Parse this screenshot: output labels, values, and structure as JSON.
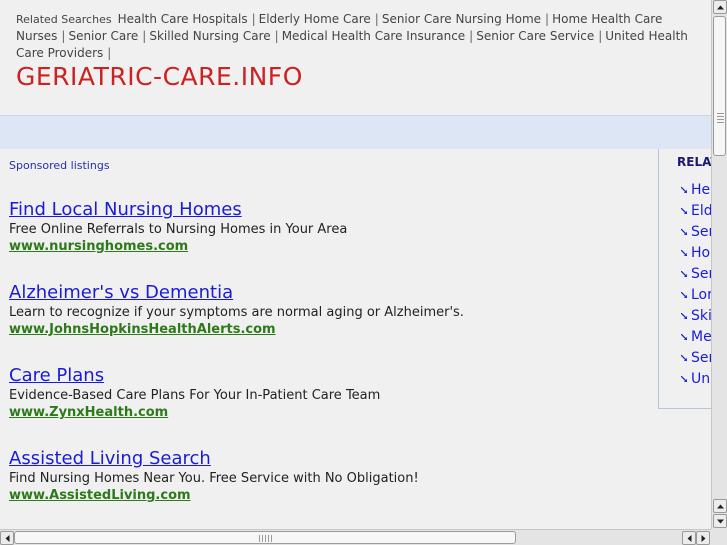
{
  "related_bar": {
    "label": "Related Searches",
    "items": [
      "Health Care Hospitals",
      "Elderly Home Care",
      "Senior Care Nursing Home",
      "Home Health Care Nurses",
      "Senior Care",
      "Skilled Nursing Care",
      "Medical Health Care Insurance",
      "Senior Care Service",
      "United Health Care Providers"
    ],
    "separator": "|"
  },
  "site_title": "GERIATRIC-CARE.INFO",
  "sponsored_label": "Sponsored listings",
  "ads": [
    {
      "title": "Find Local Nursing Homes",
      "desc": "Free Online Referrals to Nursing Homes in Your Area",
      "url": "www.nursinghomes.com"
    },
    {
      "title": "Alzheimer's vs Dementia",
      "desc": "Learn to recognize if your symptoms are normal aging or Alzheimer's.",
      "url": "www.JohnsHopkinsHealthAlerts.com"
    },
    {
      "title": "Care Plans",
      "desc": "Evidence-Based Care Plans For Your In-Patient Care Team",
      "url": "www.ZynxHealth.com"
    },
    {
      "title": "Assisted Living Search",
      "desc": "Find Nursing Homes Near You. Free Service with No Obligation!",
      "url": "www.AssistedLiving.com"
    }
  ],
  "sidebar": {
    "heading": "RELAT",
    "items": [
      "Hea",
      "Eld",
      "Ser",
      "Hor",
      "Ser",
      "Lor",
      "Ski",
      "Mec",
      "Ser",
      "Uni"
    ]
  },
  "colors": {
    "title_red": "#cc2222",
    "link_blue": "#1a1adb",
    "url_green": "#2d7a1a",
    "band_blue": "#dde6f5"
  }
}
